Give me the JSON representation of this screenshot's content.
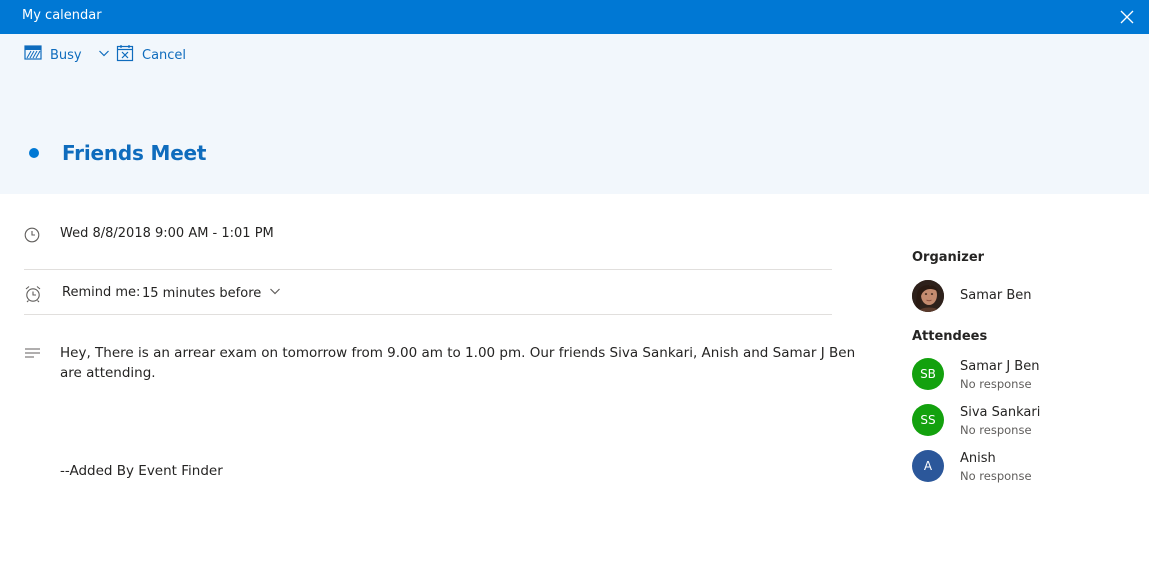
{
  "window": {
    "title": "My calendar",
    "close_icon": "close-icon"
  },
  "toolbar": {
    "busy_label": "Busy",
    "cancel_label": "Cancel"
  },
  "event": {
    "title": "Friends Meet",
    "color": "#0078d4",
    "time": "Wed 8/8/2018 9:00 AM - 1:01 PM",
    "remind_label": "Remind me:",
    "remind_value": "15 minutes before",
    "description": "Hey, There is an arrear exam on tomorrow from 9.00 am to 1.00 pm. Our friends Siva Sankari, Anish and Samar J Ben are attending.",
    "signature": "--Added By Event Finder"
  },
  "people": {
    "organizer_heading": "Organizer",
    "organizer": {
      "name": "Samar Ben"
    },
    "attendees_heading": "Attendees",
    "attendees": [
      {
        "initials": "SB",
        "name": "Samar J Ben",
        "status": "No response",
        "color": "#13a10e"
      },
      {
        "initials": "SS",
        "name": "Siva Sankari",
        "status": "No response",
        "color": "#13a10e"
      },
      {
        "initials": "A",
        "name": "Anish",
        "status": "No response",
        "color": "#2b579a"
      }
    ]
  }
}
